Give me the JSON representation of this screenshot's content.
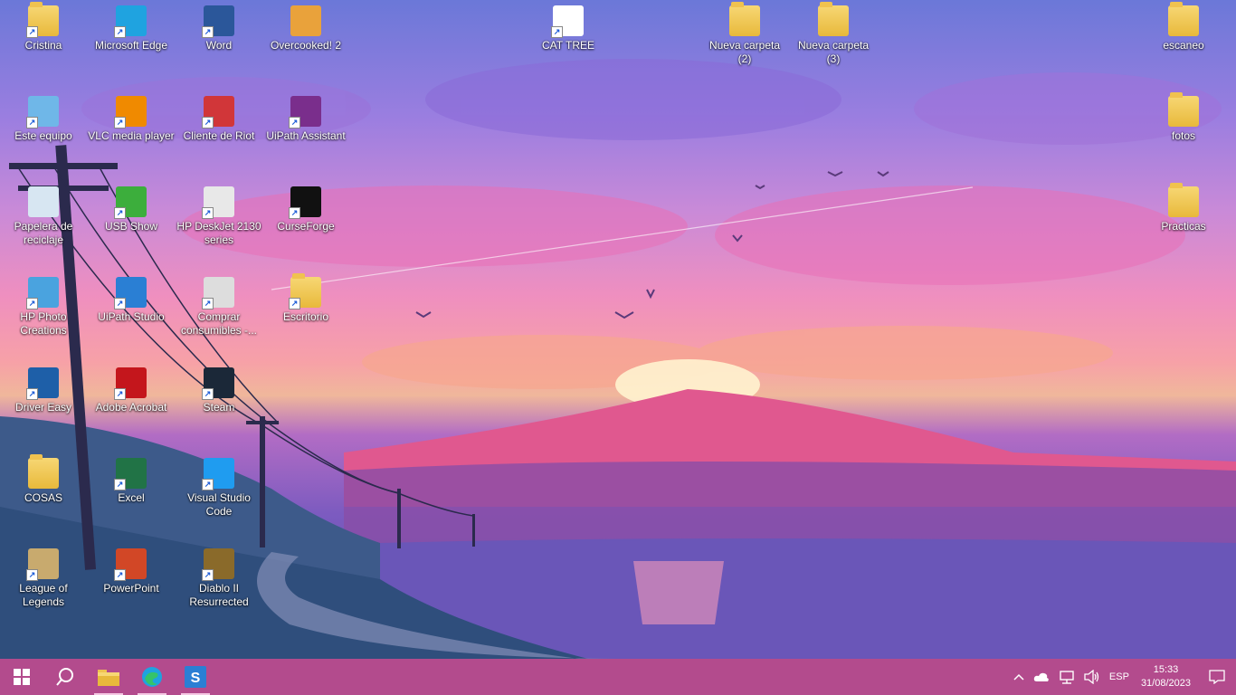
{
  "desktop": {
    "icons": [
      {
        "id": "cristina",
        "label": "Cristina",
        "icon": "user-folder-icon",
        "color": "#e8b93b"
      },
      {
        "id": "edge",
        "label": "Microsoft Edge",
        "icon": "edge-icon",
        "color": "#1fa3e0"
      },
      {
        "id": "word",
        "label": "Word",
        "icon": "word-icon",
        "color": "#2b579a"
      },
      {
        "id": "overcooked",
        "label": "Overcooked! 2",
        "icon": "overcooked-icon",
        "color": "#e9a23b"
      },
      {
        "id": "cattree",
        "label": "CAT TREE",
        "icon": "document-icon",
        "color": "#ffffff"
      },
      {
        "id": "nc2",
        "label": "Nueva carpeta (2)",
        "icon": "folder-icon",
        "color": "#e8b93b"
      },
      {
        "id": "nc3",
        "label": "Nueva carpeta (3)",
        "icon": "folder-icon",
        "color": "#e8b93b"
      },
      {
        "id": "escaneo",
        "label": "escaneo",
        "icon": "folder-icon",
        "color": "#e8b93b"
      },
      {
        "id": "este",
        "label": "Este equipo",
        "icon": "computer-icon",
        "color": "#6fb7e8"
      },
      {
        "id": "vlc",
        "label": "VLC media player",
        "icon": "vlc-icon",
        "color": "#f08a00"
      },
      {
        "id": "riot",
        "label": "Cliente de Riot",
        "icon": "riot-icon",
        "color": "#d13639"
      },
      {
        "id": "uipathassist",
        "label": "UiPath Assistant",
        "icon": "uipath-assistant-icon",
        "color": "#7a2e8c"
      },
      {
        "id": "fotos",
        "label": "fotos",
        "icon": "folder-icon",
        "color": "#e8b93b"
      },
      {
        "id": "papelera",
        "label": "Papelera de reciclaje",
        "icon": "recycle-bin-icon",
        "color": "#d7e6f2"
      },
      {
        "id": "usbshow",
        "label": "USB Show",
        "icon": "usb-show-icon",
        "color": "#3cae3c"
      },
      {
        "id": "hpdeskjet",
        "label": "HP DeskJet 2130 series",
        "icon": "printer-icon",
        "color": "#e8e8e8"
      },
      {
        "id": "curseforge",
        "label": "CurseForge",
        "icon": "curseforge-icon",
        "color": "#111111"
      },
      {
        "id": "practicas",
        "label": "Practicas",
        "icon": "folder-icon",
        "color": "#e8b93b"
      },
      {
        "id": "hpphoto",
        "label": "HP Photo Creations",
        "icon": "hp-photo-icon",
        "color": "#4aa3df"
      },
      {
        "id": "uipathstudio",
        "label": "UiPath Studio",
        "icon": "uipath-studio-icon",
        "color": "#2a7fd4"
      },
      {
        "id": "comprar",
        "label": "Comprar consumibles -...",
        "icon": "printer-store-icon",
        "color": "#dddddd"
      },
      {
        "id": "escritorio",
        "label": "Escritorio",
        "icon": "folder-icon",
        "color": "#e8b93b"
      },
      {
        "id": "drivereasy",
        "label": "Driver Easy",
        "icon": "driver-easy-icon",
        "color": "#1e5fa8"
      },
      {
        "id": "acrobat",
        "label": "Adobe Acrobat",
        "icon": "acrobat-icon",
        "color": "#c4161c"
      },
      {
        "id": "steam",
        "label": "Steam",
        "icon": "steam-icon",
        "color": "#1b2838"
      },
      {
        "id": "cosas",
        "label": "COSAS",
        "icon": "folder-icon",
        "color": "#e8b93b"
      },
      {
        "id": "excel",
        "label": "Excel",
        "icon": "excel-icon",
        "color": "#217346"
      },
      {
        "id": "vscode",
        "label": "Visual Studio Code",
        "icon": "vscode-icon",
        "color": "#1f9cf0"
      },
      {
        "id": "lol",
        "label": "League of Legends",
        "icon": "league-icon",
        "color": "#c8aa6e"
      },
      {
        "id": "powerpoint",
        "label": "PowerPoint",
        "icon": "powerpoint-icon",
        "color": "#d24726"
      },
      {
        "id": "diablo",
        "label": "Diablo II Resurrected",
        "icon": "diablo-icon",
        "color": "#8a6a2a"
      }
    ]
  },
  "taskbar": {
    "pinned": [
      {
        "name": "file-explorer",
        "icon": "folder-icon"
      },
      {
        "name": "edge",
        "icon": "edge-icon"
      },
      {
        "name": "uipath-studio",
        "icon": "uipath-studio-icon"
      }
    ],
    "tray": {
      "language": "ESP",
      "time": "15:33",
      "date": "31/08/2023"
    }
  },
  "colors": {
    "taskbar": "#b34b8d",
    "label_text": "#ffffff"
  }
}
